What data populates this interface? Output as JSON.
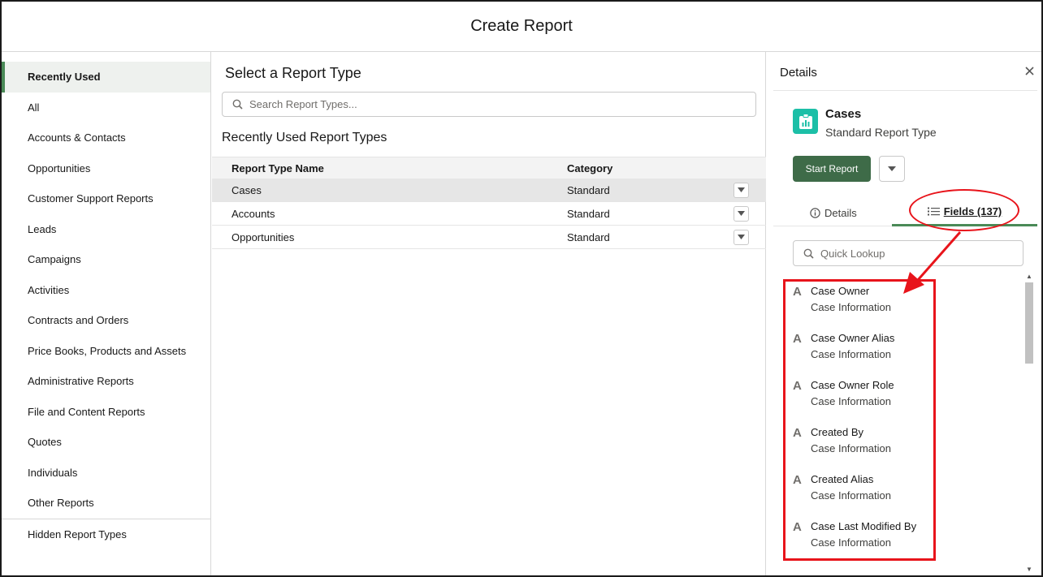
{
  "window": {
    "title": "Create Report"
  },
  "sidebar": {
    "items": [
      {
        "label": "Recently Used",
        "active": true
      },
      {
        "label": "All"
      },
      {
        "label": "Accounts & Contacts"
      },
      {
        "label": "Opportunities"
      },
      {
        "label": "Customer Support Reports"
      },
      {
        "label": "Leads"
      },
      {
        "label": "Campaigns"
      },
      {
        "label": "Activities"
      },
      {
        "label": "Contracts and Orders"
      },
      {
        "label": "Price Books, Products and Assets"
      },
      {
        "label": "Administrative Reports"
      },
      {
        "label": "File and Content Reports"
      },
      {
        "label": "Quotes"
      },
      {
        "label": "Individuals"
      },
      {
        "label": "Other Reports"
      }
    ],
    "hidden_label": "Hidden Report Types"
  },
  "main": {
    "title": "Select a Report Type",
    "search_placeholder": "Search Report Types...",
    "subtitle": "Recently Used Report Types",
    "columns": {
      "name": "Report Type Name",
      "category": "Category"
    },
    "rows": [
      {
        "name": "Cases",
        "category": "Standard",
        "selected": true
      },
      {
        "name": "Accounts",
        "category": "Standard"
      },
      {
        "name": "Opportunities",
        "category": "Standard"
      }
    ]
  },
  "details": {
    "header_title": "Details",
    "object_name": "Cases",
    "object_type": "Standard Report Type",
    "start_button": "Start Report",
    "tabs": {
      "details": "Details",
      "fields": "Fields (137)"
    },
    "quick_lookup_placeholder": "Quick Lookup",
    "fields": [
      {
        "name": "Case Owner",
        "group": "Case Information"
      },
      {
        "name": "Case Owner Alias",
        "group": "Case Information"
      },
      {
        "name": "Case Owner Role",
        "group": "Case Information"
      },
      {
        "name": "Created By",
        "group": "Case Information"
      },
      {
        "name": "Created Alias",
        "group": "Case Information"
      },
      {
        "name": "Case Last Modified By",
        "group": "Case Information"
      }
    ],
    "field_type_glyph": "A"
  },
  "colors": {
    "accent_green": "#3e6b48",
    "object_icon": "#1cbfa7",
    "annotation_red": "#e8141b"
  }
}
